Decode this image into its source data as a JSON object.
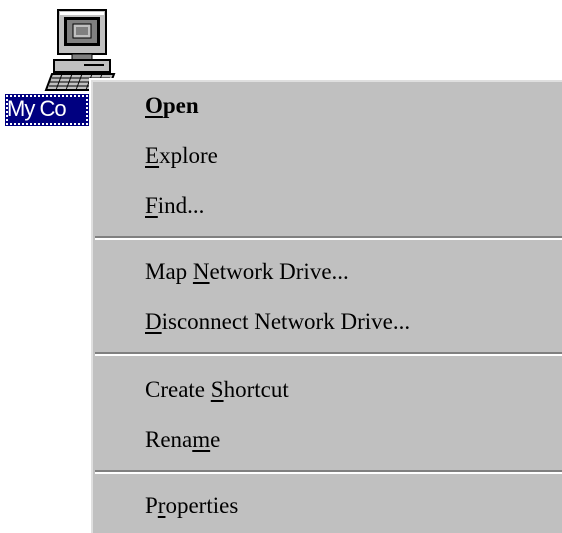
{
  "desktop": {
    "icon": {
      "name": "computer-icon",
      "label": "My Co"
    }
  },
  "context_menu": {
    "items": [
      {
        "pre": "",
        "key": "O",
        "post": "pen",
        "default": true
      },
      {
        "pre": "",
        "key": "E",
        "post": "xplore"
      },
      {
        "pre": "",
        "key": "F",
        "post": "ind..."
      },
      {
        "pre": "Map ",
        "key": "N",
        "post": "etwork Drive..."
      },
      {
        "pre": "",
        "key": "D",
        "post": "isconnect Network Drive..."
      },
      {
        "pre": "Create ",
        "key": "S",
        "post": "hortcut"
      },
      {
        "pre": "Rena",
        "key": "m",
        "post": "e"
      },
      {
        "pre": "P",
        "key": "r",
        "post": "operties"
      }
    ]
  },
  "colors": {
    "menu_face": "#c0c0c0",
    "selection": "#000080",
    "separator_shadow": "#808080",
    "separator_highlight": "#ffffff"
  }
}
